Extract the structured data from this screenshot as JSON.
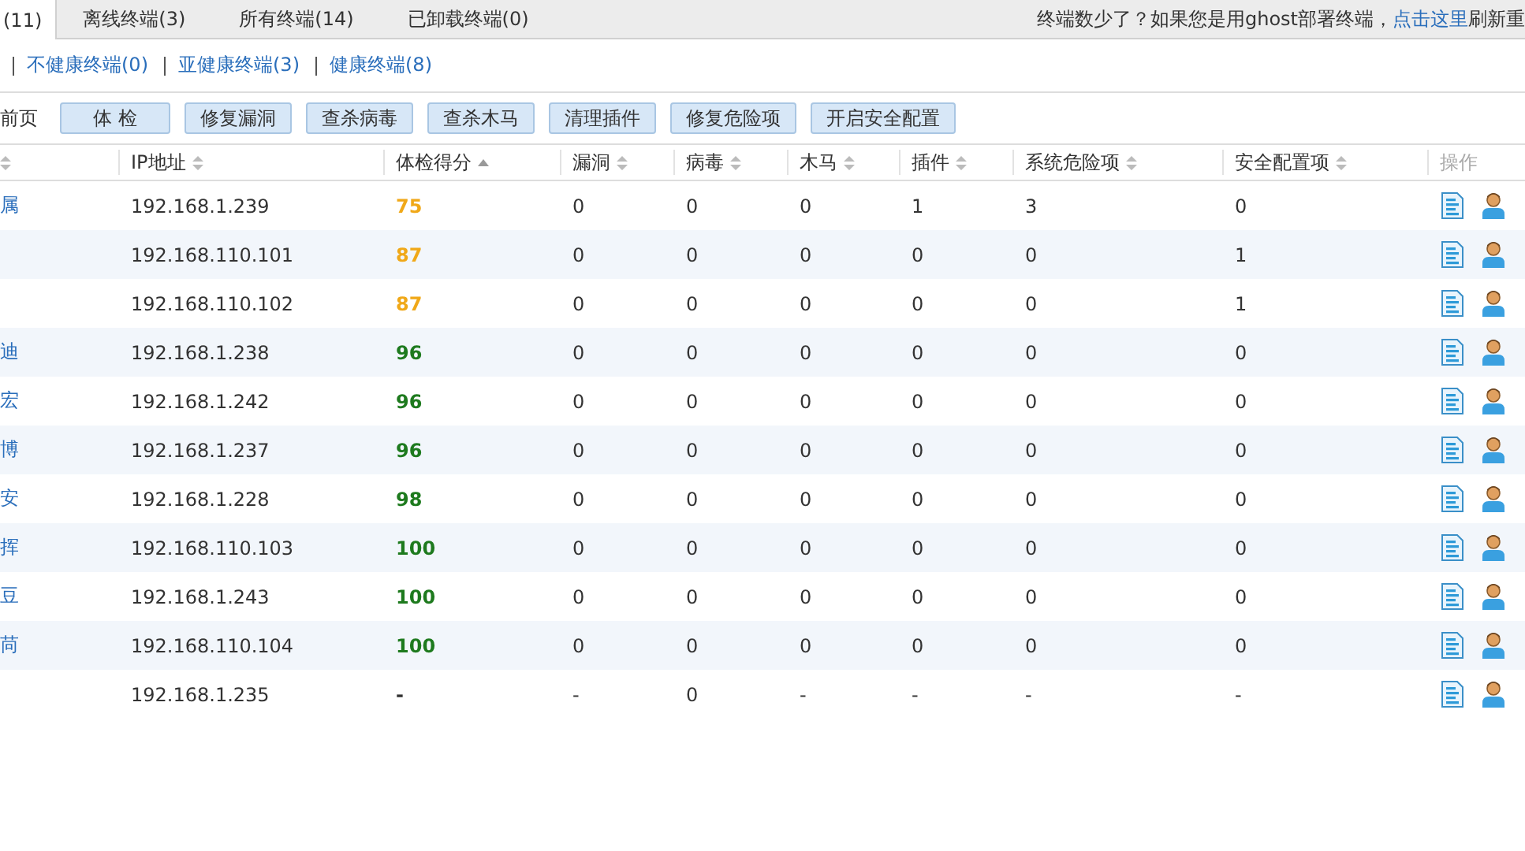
{
  "tabs": [
    {
      "label": "(11)",
      "selected": true
    },
    {
      "label": "离线终端(3)",
      "selected": false
    },
    {
      "label": "所有终端(14)",
      "selected": false
    },
    {
      "label": "已卸载终端(0)",
      "selected": false
    }
  ],
  "notice": {
    "before": "终端数少了？如果您是用ghost部署终端，",
    "link": "点击这里",
    "after": "刷新重"
  },
  "filters": [
    "不健康终端(0)",
    "亚健康终端(3)",
    "健康终端(8)"
  ],
  "toolbar": {
    "scope_label": "前页",
    "buttons": [
      "体 检",
      "修复漏洞",
      "查杀病毒",
      "查杀木马",
      "清理插件",
      "修复危险项",
      "开启安全配置"
    ]
  },
  "table": {
    "columns": [
      {
        "kind": "sortable"
      },
      {
        "label": "IP地址",
        "kind": "sortable"
      },
      {
        "label": "体检得分",
        "kind": "sorted"
      },
      {
        "label": "漏洞",
        "kind": "sortable"
      },
      {
        "label": "病毒",
        "kind": "sortable"
      },
      {
        "label": "木马",
        "kind": "sortable"
      },
      {
        "label": "插件",
        "kind": "sortable"
      },
      {
        "label": "系统危险项",
        "kind": "sortable"
      },
      {
        "label": "安全配置项",
        "kind": "sortable"
      },
      {
        "label": "操作",
        "kind": "plain"
      }
    ],
    "rows": [
      {
        "name": "属",
        "ip": "192.168.1.239",
        "score": "75",
        "color": "#f0a818",
        "counts": [
          "0",
          "0",
          "0",
          "1",
          "3",
          "0"
        ]
      },
      {
        "ip": "192.168.110.101",
        "score": "87",
        "color": "#f0a818",
        "counts": [
          "0",
          "0",
          "0",
          "0",
          "0",
          "1"
        ]
      },
      {
        "ip": "192.168.110.102",
        "score": "87",
        "color": "#f0a818",
        "counts": [
          "0",
          "0",
          "0",
          "0",
          "0",
          "1"
        ]
      },
      {
        "name": "迪",
        "ip": "192.168.1.238",
        "score": "96",
        "color": "#1e7a1e",
        "counts": [
          "0",
          "0",
          "0",
          "0",
          "0",
          "0"
        ]
      },
      {
        "name": "宏",
        "ip": "192.168.1.242",
        "score": "96",
        "color": "#1e7a1e",
        "counts": [
          "0",
          "0",
          "0",
          "0",
          "0",
          "0"
        ]
      },
      {
        "name": "博",
        "ip": "192.168.1.237",
        "score": "96",
        "color": "#1e7a1e",
        "counts": [
          "0",
          "0",
          "0",
          "0",
          "0",
          "0"
        ]
      },
      {
        "name": "安",
        "ip": "192.168.1.228",
        "score": "98",
        "color": "#1e7a1e",
        "counts": [
          "0",
          "0",
          "0",
          "0",
          "0",
          "0"
        ]
      },
      {
        "name": "挥",
        "ip": "192.168.110.103",
        "score": "100",
        "color": "#1e7a1e",
        "counts": [
          "0",
          "0",
          "0",
          "0",
          "0",
          "0"
        ]
      },
      {
        "name": "豆",
        "ip": "192.168.1.243",
        "score": "100",
        "color": "#1e7a1e",
        "counts": [
          "0",
          "0",
          "0",
          "0",
          "0",
          "0"
        ]
      },
      {
        "name": "苘",
        "ip": "192.168.110.104",
        "score": "100",
        "color": "#1e7a1e",
        "counts": [
          "0",
          "0",
          "0",
          "0",
          "0",
          "0"
        ]
      },
      {
        "ip": "192.168.1.235",
        "score": "-",
        "color": "#333333",
        "counts": [
          "-",
          "0",
          "-",
          "-",
          "-",
          "-"
        ]
      }
    ]
  }
}
